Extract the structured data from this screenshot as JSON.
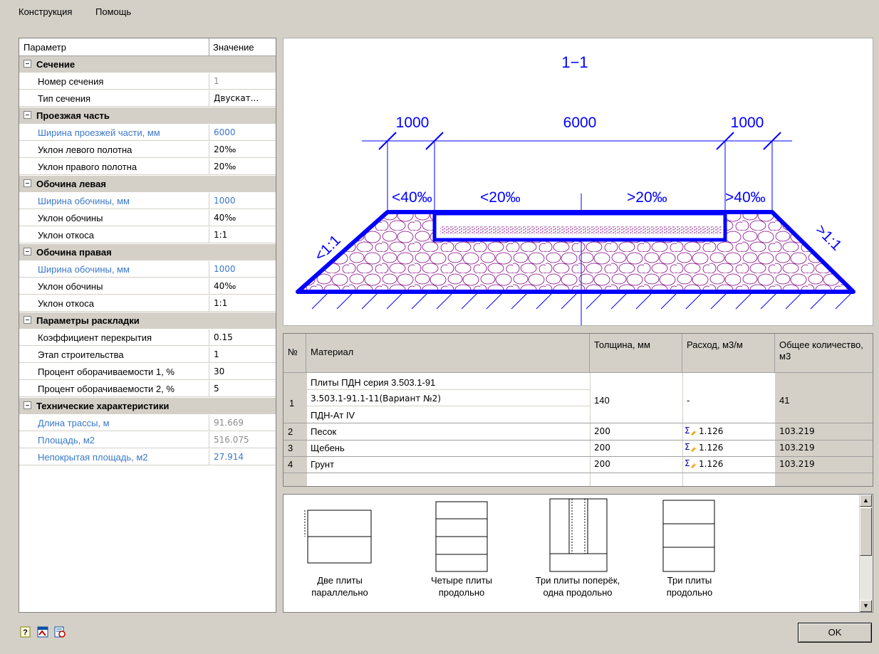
{
  "menu": {
    "items": [
      "Конструкция",
      "Помощь"
    ]
  },
  "props": {
    "header": {
      "param": "Параметр",
      "value": "Значение"
    },
    "rows": [
      {
        "type": "cat",
        "label": "Сечение"
      },
      {
        "type": "row",
        "label": "Номер сечения",
        "value": "1",
        "style": "gray-value"
      },
      {
        "type": "row",
        "label": "Тип сечения",
        "value": "Двускат...",
        "style": ""
      },
      {
        "type": "cat",
        "label": "Проезжая часть"
      },
      {
        "type": "row",
        "label": "Ширина проезжей части, мм",
        "value": "6000",
        "style": "blue"
      },
      {
        "type": "row",
        "label": "Уклон левого полотна",
        "value": "20‰",
        "style": ""
      },
      {
        "type": "row",
        "label": "Уклон правого полотна",
        "value": "20‰",
        "style": ""
      },
      {
        "type": "cat",
        "label": "Обочина левая"
      },
      {
        "type": "row",
        "label": "Ширина обочины, мм",
        "value": "1000",
        "style": "blue"
      },
      {
        "type": "row",
        "label": "Уклон обочины",
        "value": "40‰",
        "style": ""
      },
      {
        "type": "row",
        "label": "Уклон откоса",
        "value": "1:1",
        "style": ""
      },
      {
        "type": "cat",
        "label": "Обочина правая"
      },
      {
        "type": "row",
        "label": "Ширина обочины, мм",
        "value": "1000",
        "style": "blue"
      },
      {
        "type": "row",
        "label": "Уклон обочины",
        "value": "40‰",
        "style": ""
      },
      {
        "type": "row",
        "label": "Уклон откоса",
        "value": "1:1",
        "style": ""
      },
      {
        "type": "cat",
        "label": "Параметры раскладки"
      },
      {
        "type": "row",
        "label": "Коэффициент перекрытия",
        "value": "0.15",
        "style": ""
      },
      {
        "type": "row",
        "label": "Этап строительства",
        "value": "1",
        "style": ""
      },
      {
        "type": "row",
        "label": "Процент оборачиваемости 1, %",
        "value": "30",
        "style": ""
      },
      {
        "type": "row",
        "label": "Процент оборачиваемости 2, %",
        "value": "5",
        "style": ""
      },
      {
        "type": "cat",
        "label": "Технические характеристики"
      },
      {
        "type": "row",
        "label": "Длина трассы, м",
        "value": "91.669",
        "style": "blue-gray"
      },
      {
        "type": "row",
        "label": "Площадь, м2",
        "value": "516.075",
        "style": "blue-gray"
      },
      {
        "type": "row",
        "label": "Непокрытая площадь, м2",
        "value": "27.914",
        "style": "blue-blue"
      }
    ]
  },
  "drawing": {
    "section_label": "1−1",
    "dim_left": "1000",
    "dim_center": "6000",
    "dim_right": "1000",
    "slope_left_shoulder": "40‰",
    "slope_left_road": "20‰",
    "slope_right_road": "20‰",
    "slope_right_shoulder": "40‰",
    "slope_left_bank": "1:1",
    "slope_right_bank": "1:1",
    "colors": {
      "primary": "#0000ff",
      "fill": "#800080"
    }
  },
  "table": {
    "headers": {
      "num": "№",
      "material": "Материал",
      "thickness": "Толщина, мм",
      "consumption": "Расход, м3/м",
      "total": "Общее количество, м3"
    },
    "row1": {
      "num": "1",
      "material_lines": [
        "Плиты ПДН серия 3.503.1-91",
        "3.503.1-91.1-11(Вариант №2)",
        "ПДН-Ат IV"
      ],
      "thickness": "140",
      "consumption": "-",
      "total": "41"
    },
    "rows": [
      {
        "num": "2",
        "material": "Песок",
        "thickness": "200",
        "consumption": "1.126",
        "total": "103.219"
      },
      {
        "num": "3",
        "material": "Щебень",
        "thickness": "200",
        "consumption": "1.126",
        "total": "103.219"
      },
      {
        "num": "4",
        "material": "Грунт",
        "thickness": "200",
        "consumption": "1.126",
        "total": "103.219"
      }
    ]
  },
  "gallery": {
    "items": [
      {
        "label1": "Две плиты",
        "label2": "параллельно"
      },
      {
        "label1": "Четыре плиты",
        "label2": "продольно"
      },
      {
        "label1": "Три плиты поперёк,",
        "label2": "одна продольно"
      },
      {
        "label1": "Три плиты",
        "label2": "продольно"
      }
    ]
  },
  "footer": {
    "ok": "OK"
  }
}
